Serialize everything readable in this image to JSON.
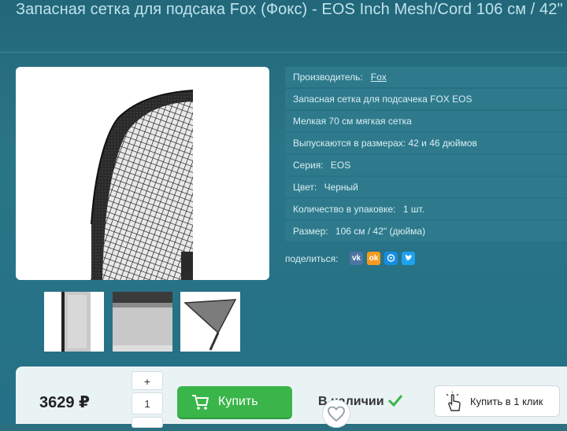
{
  "product": {
    "title": "Запасная сетка для подсака Fox (Фокс) - EOS Inch Mesh/Cord 106 см / 42\""
  },
  "specs": {
    "manufacturer_label": "Производитель:",
    "manufacturer_value": "Fox",
    "line1": "Запасная сетка для подсачека FOX EOS",
    "line2": "Мелкая 70 см мягкая сетка",
    "line3": "Выпускаются в размерах: 42 и 46 дюймов",
    "series_label": "Серия:",
    "series_value": "EOS",
    "color_label": "Цвет:",
    "color_value": "Черный",
    "qty_label": "Количество в упаковке:",
    "qty_value": "1 шт.",
    "size_label": "Размер:",
    "size_value": "106 см / 42\" (дюйма)"
  },
  "share": {
    "label": "поделиться:",
    "icons": [
      "vk-icon",
      "odnoklassniki-icon",
      "moimir-icon",
      "twitter-icon"
    ],
    "vk_text": "vk",
    "ok_text": "ok"
  },
  "purchase": {
    "price": "3629 ₽",
    "qty_plus": "+",
    "qty_value": "1",
    "buy_label": "Купить",
    "stock_label": "В наличии",
    "one_click_label": "Купить в 1 клик"
  },
  "colors": {
    "accent_green": "#3ab54a",
    "background_teal": "#2b6f80",
    "vk": "#4c75a3",
    "ok": "#f59a1e",
    "mm": "#168de2",
    "twitter": "#1da1f2"
  }
}
